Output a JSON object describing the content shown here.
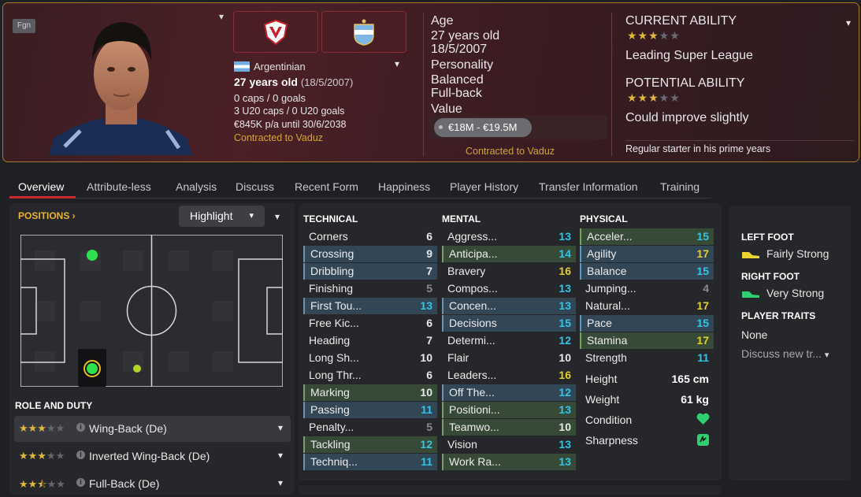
{
  "header": {
    "nationality_badge": "Fgn",
    "nationality": "Argentinian",
    "age_text": "27 years old",
    "dob_paren": "(18/5/2007)",
    "caps": "0 caps / 0 goals",
    "u20": "3 U20 caps / 0 U20 goals",
    "wage": "€845K p/a until 30/6/2038",
    "contract": "Contracted to Vaduz",
    "club_icon": "vaduz-crest-icon",
    "nation_icon": "argentina-crest-icon"
  },
  "mid": {
    "age_label": "Age",
    "age_value": "27 years old",
    "dob": "18/5/2007",
    "personality_label": "Personality",
    "personality_value": "Balanced",
    "position": "Full-back",
    "value_label": "Value",
    "value_range": "€18M - €19.5M",
    "contract": "Contracted to Vaduz"
  },
  "ability": {
    "current_label": "CURRENT ABILITY",
    "current_stars": 3,
    "current_desc": "Leading Super League",
    "potential_label": "POTENTIAL ABILITY",
    "potential_stars": 3,
    "potential_desc": "Could improve slightly",
    "summary": "Regular starter in his prime years"
  },
  "tabs": [
    "Overview",
    "Attribute-less",
    "Analysis",
    "Discuss",
    "Recent Form",
    "Happiness",
    "Player History",
    "Transfer Information",
    "Training"
  ],
  "positions": {
    "label": "POSITIONS",
    "highlight_label": "Highlight"
  },
  "roles": {
    "label": "ROLE AND DUTY",
    "items": [
      {
        "name": "Wing-Back (De)",
        "stars": 3
      },
      {
        "name": "Inverted Wing-Back (De)",
        "stars": 3
      },
      {
        "name": "Full-Back (De)",
        "stars": 2.5
      }
    ]
  },
  "attributes": {
    "technical_label": "TECHNICAL",
    "mental_label": "MENTAL",
    "physical_label": "PHYSICAL",
    "technical": [
      {
        "name": "Corners",
        "value": "6",
        "hl": "",
        "c": "w"
      },
      {
        "name": "Crossing",
        "value": "9",
        "hl": "b",
        "c": "w"
      },
      {
        "name": "Dribbling",
        "value": "7",
        "hl": "b",
        "c": "w"
      },
      {
        "name": "Finishing",
        "value": "5",
        "hl": "",
        "c": "g"
      },
      {
        "name": "First Tou...",
        "value": "13",
        "hl": "b",
        "c": "b"
      },
      {
        "name": "Free Kic...",
        "value": "6",
        "hl": "",
        "c": "w"
      },
      {
        "name": "Heading",
        "value": "7",
        "hl": "",
        "c": "w"
      },
      {
        "name": "Long Sh...",
        "value": "10",
        "hl": "",
        "c": "w"
      },
      {
        "name": "Long Thr...",
        "value": "6",
        "hl": "",
        "c": "w"
      },
      {
        "name": "Marking",
        "value": "10",
        "hl": "g",
        "c": "w"
      },
      {
        "name": "Passing",
        "value": "11",
        "hl": "b",
        "c": "b"
      },
      {
        "name": "Penalty...",
        "value": "5",
        "hl": "",
        "c": "g"
      },
      {
        "name": "Tackling",
        "value": "12",
        "hl": "g",
        "c": "b"
      },
      {
        "name": "Techniq...",
        "value": "11",
        "hl": "b",
        "c": "b"
      }
    ],
    "mental": [
      {
        "name": "Aggress...",
        "value": "13",
        "hl": "",
        "c": "b"
      },
      {
        "name": "Anticipa...",
        "value": "14",
        "hl": "g",
        "c": "b"
      },
      {
        "name": "Bravery",
        "value": "16",
        "hl": "",
        "c": "y"
      },
      {
        "name": "Compos...",
        "value": "13",
        "hl": "",
        "c": "b"
      },
      {
        "name": "Concen...",
        "value": "13",
        "hl": "b",
        "c": "b"
      },
      {
        "name": "Decisions",
        "value": "15",
        "hl": "b",
        "c": "b"
      },
      {
        "name": "Determi...",
        "value": "12",
        "hl": "",
        "c": "b"
      },
      {
        "name": "Flair",
        "value": "10",
        "hl": "",
        "c": "w"
      },
      {
        "name": "Leaders...",
        "value": "16",
        "hl": "",
        "c": "y"
      },
      {
        "name": "Off The...",
        "value": "12",
        "hl": "b",
        "c": "b"
      },
      {
        "name": "Positioni...",
        "value": "13",
        "hl": "g",
        "c": "b"
      },
      {
        "name": "Teamwo...",
        "value": "10",
        "hl": "g",
        "c": "w"
      },
      {
        "name": "Vision",
        "value": "13",
        "hl": "",
        "c": "b"
      },
      {
        "name": "Work Ra...",
        "value": "13",
        "hl": "g",
        "c": "b"
      }
    ],
    "physical": [
      {
        "name": "Acceler...",
        "value": "15",
        "hl": "g",
        "c": "b"
      },
      {
        "name": "Agility",
        "value": "17",
        "hl": "b",
        "c": "y"
      },
      {
        "name": "Balance",
        "value": "15",
        "hl": "b",
        "c": "b"
      },
      {
        "name": "Jumping...",
        "value": "4",
        "hl": "",
        "c": "g"
      },
      {
        "name": "Natural...",
        "value": "17",
        "hl": "",
        "c": "y"
      },
      {
        "name": "Pace",
        "value": "15",
        "hl": "b",
        "c": "b"
      },
      {
        "name": "Stamina",
        "value": "17",
        "hl": "g",
        "c": "y"
      },
      {
        "name": "Strength",
        "value": "11",
        "hl": "",
        "c": "b"
      }
    ],
    "height_label": "Height",
    "height": "165 cm",
    "weight_label": "Weight",
    "weight": "61 kg",
    "condition_label": "Condition",
    "condition_icon": "heart-icon",
    "sharpness_label": "Sharpness",
    "sharpness_icon": "sharpness-icon"
  },
  "feet": {
    "left_label": "LEFT FOOT",
    "left_value": "Fairly Strong",
    "right_label": "RIGHT FOOT",
    "right_value": "Very Strong",
    "traits_label": "PLAYER TRAITS",
    "traits_value": "None",
    "discuss": "Discuss new tr..."
  },
  "colors": {
    "accent": "#c72a2a",
    "gold": "#d2a63b",
    "blue_value": "#2ec7ea",
    "yellow_value": "#e2cf2e"
  }
}
